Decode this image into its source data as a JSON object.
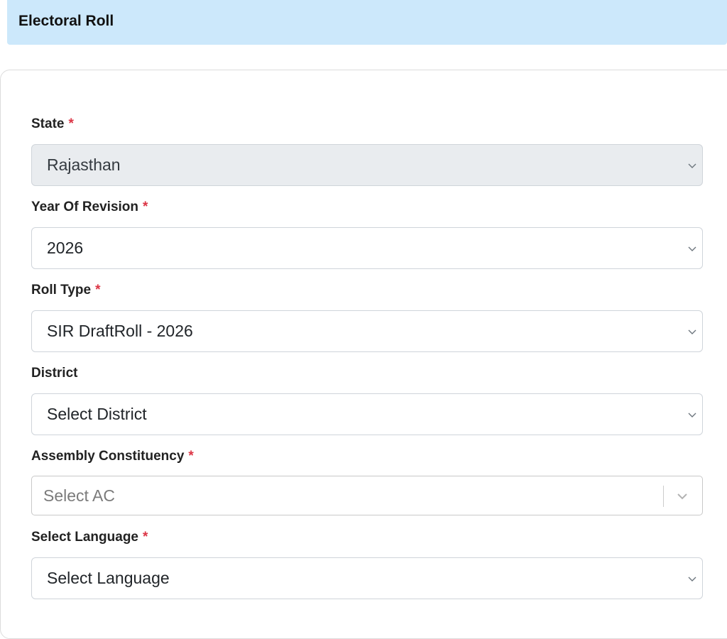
{
  "header": {
    "title": "Electoral Roll"
  },
  "form": {
    "required_marker": "*",
    "state": {
      "label": "State",
      "value": "Rajasthan",
      "disabled": true
    },
    "year_of_revision": {
      "label": "Year Of Revision",
      "value": "2026"
    },
    "roll_type": {
      "label": "Roll Type",
      "value": "SIR DraftRoll - 2026"
    },
    "district": {
      "label": "District",
      "value": "Select District"
    },
    "assembly_constituency": {
      "label": "Assembly Constituency",
      "placeholder": "Select AC"
    },
    "language": {
      "label": "Select Language",
      "value": "Select Language"
    }
  },
  "icons": {
    "dropdown": "chevron-down-icon"
  },
  "colors": {
    "header_bg": "#cce8fb",
    "required": "#dc3545",
    "disabled_bg": "#e9ecef"
  }
}
